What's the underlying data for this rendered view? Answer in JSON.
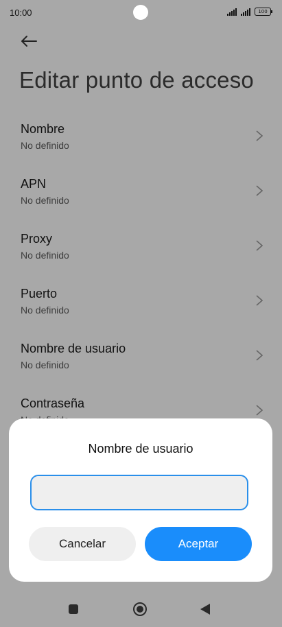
{
  "status": {
    "time": "10:00",
    "battery": "100",
    "icons": [
      "signal-icon",
      "signal-icon",
      "battery-icon"
    ]
  },
  "header": {
    "back_icon": "arrow-left-icon",
    "title": "Editar punto de acceso"
  },
  "settings": [
    {
      "title": "Nombre",
      "value": "No definido"
    },
    {
      "title": "APN",
      "value": "No definido"
    },
    {
      "title": "Proxy",
      "value": "No definido"
    },
    {
      "title": "Puerto",
      "value": "No definido"
    },
    {
      "title": "Nombre de usuario",
      "value": "No definido"
    },
    {
      "title": "Contraseña",
      "value": "No definido"
    }
  ],
  "dialog": {
    "title": "Nombre de usuario",
    "input_value": "",
    "cancel_label": "Cancelar",
    "ok_label": "Aceptar"
  },
  "colors": {
    "accent": "#1a8dfb",
    "input_border": "#2a8fea",
    "scrim_background": "#a8a8a8"
  },
  "nav": {
    "icons": [
      "recent-apps-icon",
      "home-icon",
      "back-triangle-icon"
    ]
  }
}
